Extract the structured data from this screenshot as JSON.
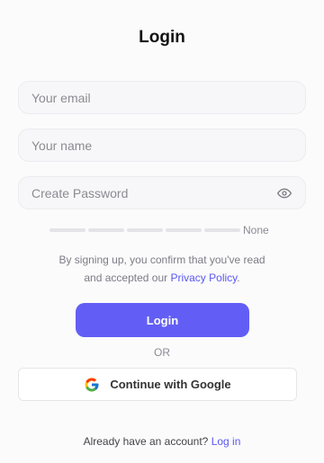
{
  "title": "Login",
  "fields": {
    "email": {
      "placeholder": "Your email",
      "value": ""
    },
    "name": {
      "placeholder": "Your name",
      "value": ""
    },
    "password": {
      "placeholder": "Create Password",
      "value": "",
      "toggle_icon": "eye-icon"
    }
  },
  "password_strength": {
    "label": "None",
    "segments": 5,
    "filled": 0
  },
  "terms": {
    "text_line1": "By signing up, you confirm that you've read",
    "text_line2": "and accepted our",
    "link": "Privacy Policy",
    "end": "."
  },
  "login_button": "Login",
  "divider": "OR",
  "google_button": {
    "label": "Continue with Google",
    "icon": "google-icon"
  },
  "footer": {
    "text": "Already have an account?",
    "link": "Log in"
  },
  "colors": {
    "accent": "#625ef5",
    "link": "#5b57f2",
    "background": "#fbfbfc",
    "field_bg": "#f7f7f9"
  }
}
